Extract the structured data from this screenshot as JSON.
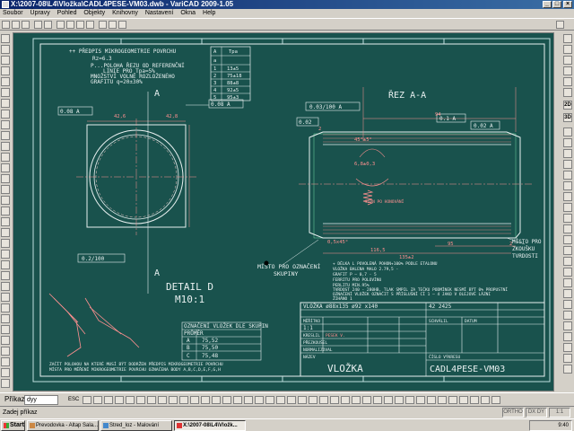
{
  "window": {
    "title": "X:\\2007-08\\L4\\Vložka\\CADL4PESE-VM03.dwb - VariCAD 2009-1.05",
    "buttons": [
      "_",
      "□",
      "×"
    ]
  },
  "menu": [
    "Soubor",
    "Úpravy",
    "Pohled",
    "Objekty",
    "Knihovny",
    "Nastavení",
    "Okna",
    "Help"
  ],
  "right_toolbar": {
    "mode_2d": "2D",
    "mode_3d": "3D"
  },
  "drawing": {
    "notes_top": [
      "++ PŘEDPIS MIKROGEOMETRIE POVRCHU",
      "Rz=6.3",
      "P...POLOHA ŘEZU OD REFERENČNÍ",
      "LINIE PRO Tpa=5%",
      "MNOŽSTVÍ VOLNĚ ROZLOŽENÉHO",
      "GRAFITU q=20±30%"
    ],
    "small_table": {
      "headers": [
        "A",
        "Tpa",
        "a"
      ],
      "rows": [
        [
          "1",
          "13±5"
        ],
        [
          "2",
          "75±18"
        ],
        [
          "3",
          "88±8"
        ],
        [
          "4",
          "92±5"
        ],
        [
          "5",
          "95±3"
        ]
      ]
    },
    "section_label": "ŘEZ A-A",
    "detail_label": "DETAIL D",
    "detail_scale": "M10:1",
    "section_marker": "A",
    "tolerance_labels": [
      "0.08 A",
      "0.08 A",
      "0.03/100 A",
      "0.02",
      "0.1 A",
      "0.02 A",
      "0.2/100"
    ],
    "dims": {
      "d1": "42,6",
      "d2": "42,8",
      "d3": "94",
      "d4": "2",
      "d5": "116,5",
      "d6": "95",
      "d7": "2",
      "d8": "135±2",
      "d9": "45°±5°",
      "d10": "6,8±0,3",
      "d11": "0,5x45°"
    },
    "spring_label": "35PN PO HONOVÁNÍ",
    "marker_label_1": "MÍSTO PRO OZNAČENÍ",
    "marker_label_2": "SKUPINY",
    "test_label_1": "MÍSTO PRO",
    "test_label_2": "ZKOUŠKU",
    "test_label_3": "TVRDOSTI",
    "mid_notes": [
      "+ DÉLKA L POVOLENÁ POHON+100% PODLE ETALONU",
      "VLOŽKA BALENA MALO 2.79,5 -",
      "GRAFIT P – 0,7 - 5",
      "FERRITU PRO POLOVÍNU",
      "PERLITU MIN.95%",
      "TVRDOST 240 - 280HB, TLAK SMPIL ZA TEČKU PODMÍNEK NESMÍ BÝT 0% PROPUSTNÍ",
      "OZNAČENÍ VLOŽEK OZNAČIT S PŘÍSLUŠNÍ CÍ 1 – 4 JAKO V OLEJOVÉ LÁZNI",
      "ŽIHÁNO 1"
    ],
    "marking_title": "OZNAČENÍ VLOŽEK DLE SKUPIN",
    "marking_col": "PRŮMĚR",
    "marking_rows": [
      [
        "A",
        "75,52"
      ],
      [
        "B",
        "75,50"
      ],
      [
        "C",
        "75,48"
      ]
    ],
    "bottom_note_1": "ZAČÍT POLOHOU NA KTERÉ MUSÍ BÝT DODRŽEN PŘEDPIS MIKROGEOMETRIE POVRCHU",
    "bottom_note_2": "MÍSTA PRO MĚŘENÍ MIKROGEOMETRIE POVRCHU OZNAČENA BODY A,B,C,D,E,F,G,H",
    "title_block": {
      "part": "VLOŽKA ø88x135 ø92 x140",
      "material": "42 2425",
      "name": "VLOŽKA",
      "drawing_no": "CADL4PESE-VM03",
      "author": "PESEK V.",
      "drawn_label": "KRESLIL",
      "check_label": "PŘEZKOUŠEL",
      "norm_label": "NORMALIZOVAL",
      "approve_label": "SCHVÁLIL",
      "date_label": "DATUM",
      "name_label": "NÁZEV",
      "number_label": "ČÍSLO VÝKRESU",
      "scale_label": "MĚŘÍTKO",
      "scale_value": "1:1"
    }
  },
  "command": {
    "label": "Příkaz:",
    "value": "dyy",
    "esc": "ESC"
  },
  "status": {
    "text": "Zadej příkaz",
    "boxes": [
      "ORTHO",
      "DX DY",
      "1:1"
    ]
  },
  "taskbar": {
    "start": "Start",
    "tasks": [
      "Prevodovka - Altap Sala...",
      "Stred_loz - Malování",
      "X:\\2007-08\\L4\\Vložk..."
    ],
    "clock": "9:40"
  }
}
